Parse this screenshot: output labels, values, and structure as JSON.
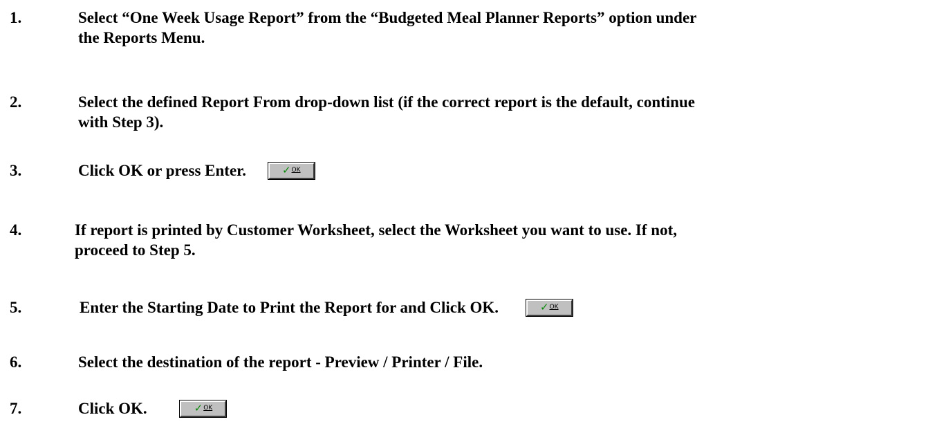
{
  "steps": [
    {
      "number": "1.",
      "lines": [
        "Select “One Week Usage Report” from the “Budgeted Meal Planner Reports” option under",
        "the Reports Menu."
      ]
    },
    {
      "number": "2.",
      "lines": [
        "Select the defined Report From drop-down list (if the correct report is the default, continue",
        "with Step 3)."
      ]
    },
    {
      "number": "3.",
      "lines": [
        "Click OK or press Enter."
      ],
      "button": {
        "check_icon": "✓",
        "label": "OK"
      }
    },
    {
      "number": "4.",
      "lines": [
        "If report is printed by Customer Worksheet, select the Worksheet you want to use.  If not,",
        "proceed to Step 5."
      ]
    },
    {
      "number": "5.",
      "lines": [
        "Enter the Starting Date to Print the Report for and Click OK."
      ],
      "button": {
        "check_icon": "✓",
        "label": "OK"
      }
    },
    {
      "number": "6.",
      "lines": [
        "Select the destination of the report - Preview / Printer / File."
      ]
    },
    {
      "number": "7.",
      "lines": [
        "Click OK."
      ],
      "button": {
        "check_icon": "✓",
        "label": "OK"
      }
    }
  ]
}
